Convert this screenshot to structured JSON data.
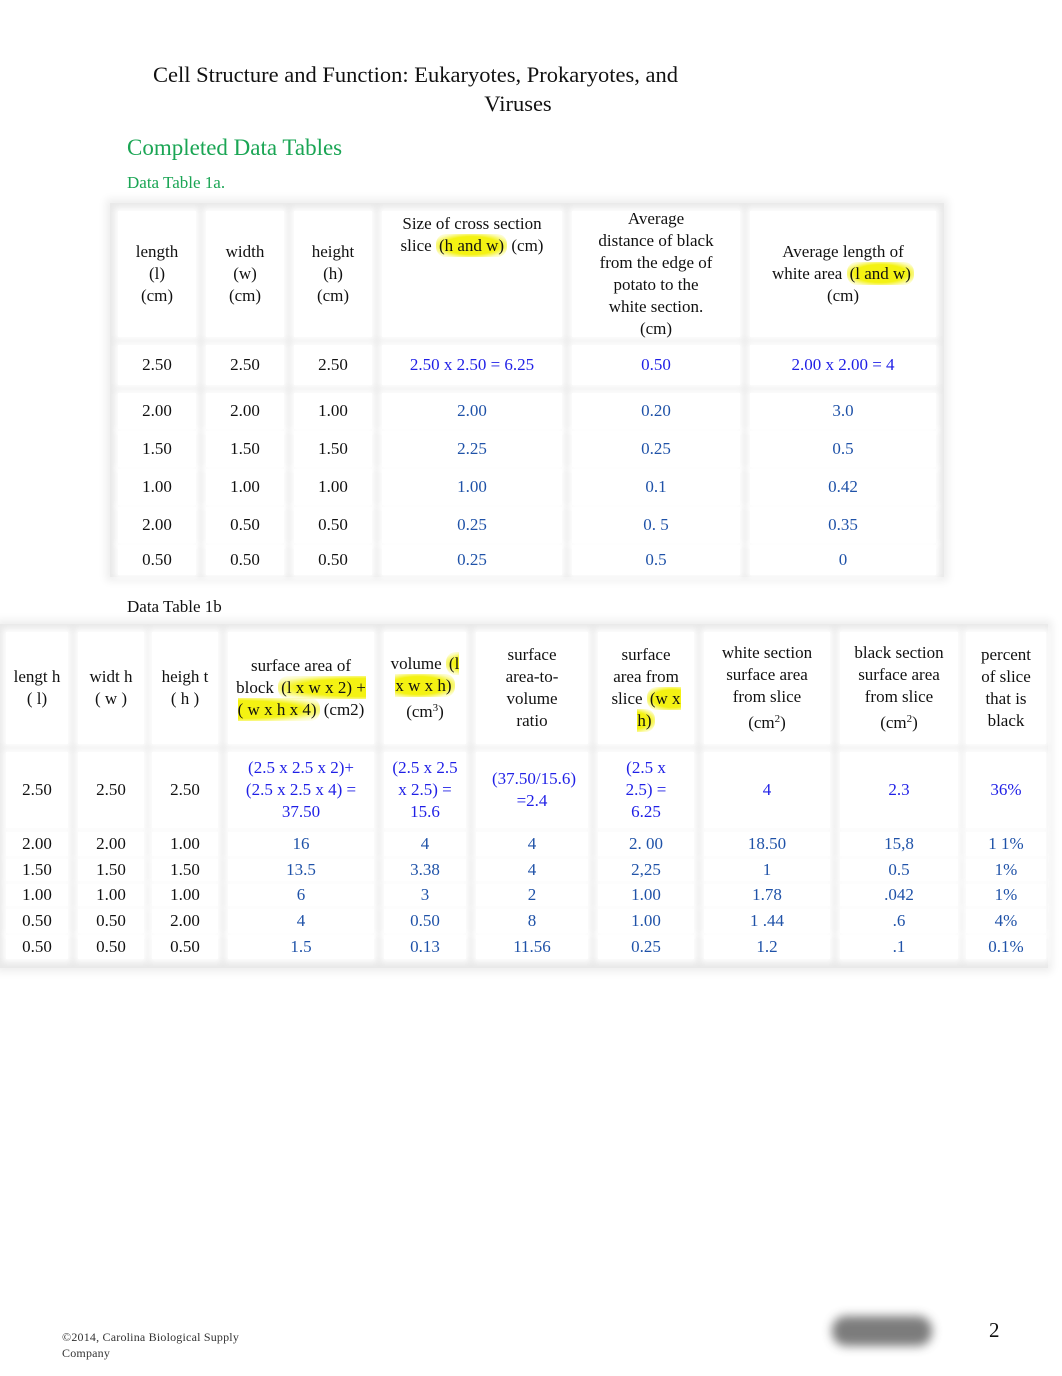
{
  "document": {
    "title_line1": "Cell Structure and Function: Eukaryotes, Prokaryotes, and",
    "title_line2": "Viruses",
    "section_heading": "Completed Data Tables",
    "colors": {
      "heading_green": "#1aa554",
      "answer_blue_bright": "#1f1fe6",
      "answer_blue_dark": "#1f52a8",
      "highlight_yellow": "#f4f212"
    }
  },
  "table1a": {
    "caption": "Data Table 1a.",
    "headers": [
      {
        "lines": [
          "length",
          "(l)",
          "(cm)"
        ]
      },
      {
        "lines": [
          "width",
          "(w)",
          "(cm)"
        ]
      },
      {
        "lines": [
          "height",
          "(h)",
          "(cm)"
        ]
      },
      {
        "text": "Size of cross section slice",
        "highlight": "(h and w)",
        "suffix": "(cm)"
      },
      {
        "lines": [
          "Average",
          "distance of black",
          "from the edge of",
          "potato to the",
          "white section.",
          "(cm)"
        ]
      },
      {
        "text": "Average length of white area",
        "highlight": "(l and w)",
        "suffix": "(cm)"
      }
    ],
    "rows": [
      [
        "2.50",
        "2.50",
        "2.50",
        "2.50 x 2.50 = 6.25",
        "0.50",
        "2.00 x 2.00 = 4"
      ],
      [
        "2.00",
        "2.00",
        "1.00",
        "2.00",
        "0.20",
        "3.0"
      ],
      [
        "1.50",
        "1.50",
        "1.50",
        "2.25",
        "0.25",
        "0.5"
      ],
      [
        "1.00",
        "1.00",
        "1.00",
        "1.00",
        "0.1",
        "0.42"
      ],
      [
        "2.00",
        "0.50",
        "0.50",
        "0.25",
        "0. 5",
        "0.35"
      ],
      [
        "0.50",
        "0.50",
        "0.50",
        "0.25",
        "0.5",
        "0"
      ]
    ]
  },
  "table1b": {
    "caption": "Data Table 1b",
    "headers": [
      {
        "text": "lengt h ( l)"
      },
      {
        "text": "widt h ( w )"
      },
      {
        "text": "heigh t ( h )"
      },
      {
        "text": "surface area of block",
        "highlight": "(l x w x 2) + ( w x h x 4)",
        "suffix": "(cm2)"
      },
      {
        "text": "volume",
        "highlight": "(l x w x h)",
        "suffix": "(cm",
        "sup": "3",
        "close": ")"
      },
      {
        "text": "surface area-to-volume ratio"
      },
      {
        "text": "surface area from slice",
        "highlight": "(w x h)"
      },
      {
        "text": "white section surface area from slice (cm",
        "sup": "2",
        "close": ")"
      },
      {
        "text": "black section surface area from slice (cm",
        "sup": "2",
        "close": ")"
      },
      {
        "text": "percent of slice that is black"
      }
    ],
    "rows": [
      [
        "2.50",
        "2.50",
        "2.50",
        "(2.5 x 2.5 x 2)+(2.5 x 2.5 x 4) = 37.50",
        "(2.5 x 2.5 x 2.5) = 15.6",
        "(37.50/15.6) =2.4",
        "(2.5 x 2.5) = 6.25",
        "4",
        "2.3",
        "36%"
      ],
      [
        "2.00",
        "2.00",
        "1.00",
        "16",
        "4",
        "4",
        "2. 00",
        "18.50",
        "15,8",
        "1 1%"
      ],
      [
        "1.50",
        "1.50",
        "1.50",
        "13.5",
        "3.38",
        "4",
        "2,25",
        "1",
        "0.5",
        "1%"
      ],
      [
        "1.00",
        "1.00",
        "1.00",
        "6",
        "3",
        "2",
        "1.00",
        "1.78",
        ".042",
        "1%"
      ],
      [
        "0.50",
        "0.50",
        "2.00",
        "4",
        "0.50",
        "8",
        "1.00",
        "1 .44",
        ".6",
        "4%"
      ],
      [
        "0.50",
        "0.50",
        "0.50",
        "1.5",
        "0.13",
        "11.56",
        "0.25",
        "1.2",
        ".1",
        "0.1%"
      ]
    ]
  },
  "footer": {
    "copyright_line1": "©2014, Carolina Biological Supply",
    "copyright_line2": "Company",
    "page_number": "2"
  }
}
